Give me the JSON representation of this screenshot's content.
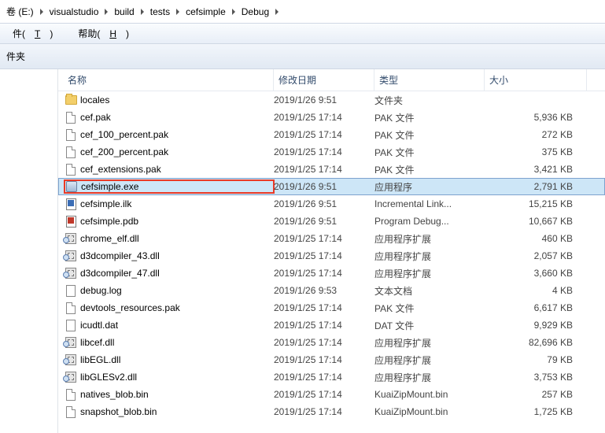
{
  "breadcrumb": [
    "卷 (E:)",
    "visualstudio",
    "build",
    "tests",
    "cefsimple",
    "Debug"
  ],
  "menu": {
    "item1_pre": "件(",
    "item1_u": "T",
    "item1_post": ")",
    "item2_pre": "帮助(",
    "item2_u": "H",
    "item2_post": ")"
  },
  "section_label": "件夹",
  "columns": {
    "name": "名称",
    "date": "修改日期",
    "type": "类型",
    "size": "大小"
  },
  "files": [
    {
      "name": "locales",
      "date": "2019/1/26 9:51",
      "type": "文件夹",
      "size": "",
      "icon": "folder",
      "selected": false,
      "highlighted": false
    },
    {
      "name": "cef.pak",
      "date": "2019/1/25 17:14",
      "type": "PAK 文件",
      "size": "5,936 KB",
      "icon": "doc",
      "selected": false,
      "highlighted": false
    },
    {
      "name": "cef_100_percent.pak",
      "date": "2019/1/25 17:14",
      "type": "PAK 文件",
      "size": "272 KB",
      "icon": "doc",
      "selected": false,
      "highlighted": false
    },
    {
      "name": "cef_200_percent.pak",
      "date": "2019/1/25 17:14",
      "type": "PAK 文件",
      "size": "375 KB",
      "icon": "doc",
      "selected": false,
      "highlighted": false
    },
    {
      "name": "cef_extensions.pak",
      "date": "2019/1/25 17:14",
      "type": "PAK 文件",
      "size": "3,421 KB",
      "icon": "doc",
      "selected": false,
      "highlighted": false
    },
    {
      "name": "cefsimple.exe",
      "date": "2019/1/26 9:51",
      "type": "应用程序",
      "size": "2,791 KB",
      "icon": "exe",
      "selected": true,
      "highlighted": true
    },
    {
      "name": "cefsimple.ilk",
      "date": "2019/1/26 9:51",
      "type": "Incremental Link...",
      "size": "15,215 KB",
      "icon": "ilk",
      "selected": false,
      "highlighted": false
    },
    {
      "name": "cefsimple.pdb",
      "date": "2019/1/26 9:51",
      "type": "Program Debug...",
      "size": "10,667 KB",
      "icon": "pdb",
      "selected": false,
      "highlighted": false
    },
    {
      "name": "chrome_elf.dll",
      "date": "2019/1/25 17:14",
      "type": "应用程序扩展",
      "size": "460 KB",
      "icon": "dll",
      "selected": false,
      "highlighted": false
    },
    {
      "name": "d3dcompiler_43.dll",
      "date": "2019/1/25 17:14",
      "type": "应用程序扩展",
      "size": "2,057 KB",
      "icon": "dll",
      "selected": false,
      "highlighted": false
    },
    {
      "name": "d3dcompiler_47.dll",
      "date": "2019/1/25 17:14",
      "type": "应用程序扩展",
      "size": "3,660 KB",
      "icon": "dll",
      "selected": false,
      "highlighted": false
    },
    {
      "name": "debug.log",
      "date": "2019/1/26 9:53",
      "type": "文本文档",
      "size": "4 KB",
      "icon": "txt",
      "selected": false,
      "highlighted": false
    },
    {
      "name": "devtools_resources.pak",
      "date": "2019/1/25 17:14",
      "type": "PAK 文件",
      "size": "6,617 KB",
      "icon": "doc",
      "selected": false,
      "highlighted": false
    },
    {
      "name": "icudtl.dat",
      "date": "2019/1/25 17:14",
      "type": "DAT 文件",
      "size": "9,929 KB",
      "icon": "dat",
      "selected": false,
      "highlighted": false
    },
    {
      "name": "libcef.dll",
      "date": "2019/1/25 17:14",
      "type": "应用程序扩展",
      "size": "82,696 KB",
      "icon": "dll",
      "selected": false,
      "highlighted": false
    },
    {
      "name": "libEGL.dll",
      "date": "2019/1/25 17:14",
      "type": "应用程序扩展",
      "size": "79 KB",
      "icon": "dll",
      "selected": false,
      "highlighted": false
    },
    {
      "name": "libGLESv2.dll",
      "date": "2019/1/25 17:14",
      "type": "应用程序扩展",
      "size": "3,753 KB",
      "icon": "dll",
      "selected": false,
      "highlighted": false
    },
    {
      "name": "natives_blob.bin",
      "date": "2019/1/25 17:14",
      "type": "KuaiZipMount.bin",
      "size": "257 KB",
      "icon": "doc",
      "selected": false,
      "highlighted": false
    },
    {
      "name": "snapshot_blob.bin",
      "date": "2019/1/25 17:14",
      "type": "KuaiZipMount.bin",
      "size": "1,725 KB",
      "icon": "doc",
      "selected": false,
      "highlighted": false
    }
  ]
}
